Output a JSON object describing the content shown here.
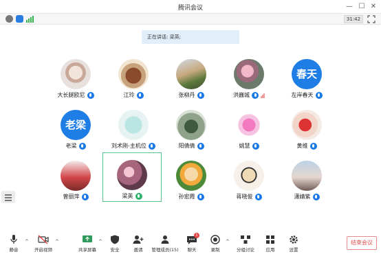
{
  "window": {
    "title": "腾讯会议"
  },
  "status": {
    "timer": "31:42"
  },
  "banner": {
    "text": "正在讲话: 梁英;"
  },
  "participants": [
    {
      "name": "大长腿欧尼",
      "mic": "blue",
      "avatar": "photo"
    },
    {
      "name": "江玲",
      "mic": "blue",
      "avatar": "photo"
    },
    {
      "name": "张柳丹",
      "mic": "blue",
      "avatar": "photo"
    },
    {
      "name": "洪巍城",
      "mic": "blue",
      "avatar": "photo"
    },
    {
      "name": "左岸春天",
      "mic": "blue",
      "avatar": "text",
      "avatar_text": "春天"
    },
    {
      "name": "老梁",
      "mic": "blue",
      "avatar": "text",
      "avatar_text": "老梁"
    },
    {
      "name": "刘术刚-主机位",
      "mic": "blue",
      "avatar": "photo"
    },
    {
      "name": "阳倩倩",
      "mic": "blue",
      "avatar": "photo"
    },
    {
      "name": "姚慧",
      "mic": "blue",
      "avatar": "photo"
    },
    {
      "name": "黄维",
      "mic": "blue",
      "avatar": "photo"
    },
    {
      "name": "曾丽萍",
      "mic": "blue",
      "avatar": "photo"
    },
    {
      "name": "梁英",
      "mic": "green",
      "avatar": "photo",
      "active": true
    },
    {
      "name": "孙宏霞",
      "mic": "blue",
      "avatar": "photo"
    },
    {
      "name": "蒋晓俊",
      "mic": "blue",
      "avatar": "photo"
    },
    {
      "name": "潇婧紫",
      "mic": "blue",
      "avatar": "photo"
    }
  ],
  "toolbar": {
    "mute": "静音",
    "video": "开启视频",
    "share": "共享屏幕",
    "security": "安全",
    "invite": "邀请",
    "manage": "管理成员(15)",
    "chat": "聊天",
    "chat_badge": "1",
    "record": "录制",
    "breakout": "分组讨论",
    "apps": "应用",
    "settings": "设置",
    "end": "结束会议"
  },
  "colors": {
    "accent": "#1a79e8",
    "speaking": "#2fb36a",
    "danger": "#e05050",
    "active_border": "#5cc48a"
  }
}
